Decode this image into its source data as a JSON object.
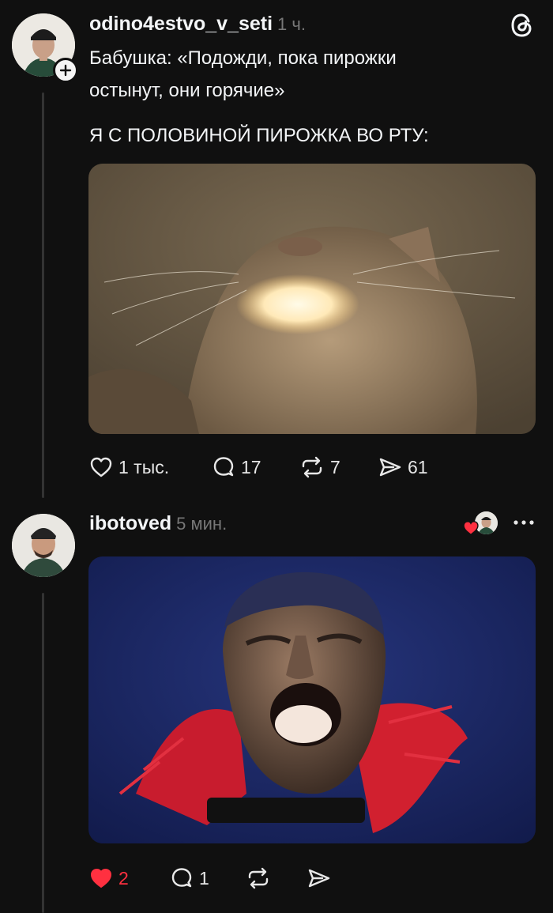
{
  "post1": {
    "username": "odino4estvo_v_seti",
    "time": "1 ч.",
    "text_line1": "Бабушка: «Подожди, пока пирожки",
    "text_line2": "остынут, они горячие»",
    "text_line3": "Я С ПОЛОВИНОЙ ПИРОЖКА ВО РТУ:",
    "actions": {
      "likes": "1 тыс.",
      "comments": "17",
      "reposts": "7",
      "shares": "61"
    }
  },
  "post2": {
    "username": "ibotoved",
    "time": "5 мин.",
    "actions": {
      "likes": "2",
      "comments": "1"
    }
  },
  "icons": {
    "app_logo": "threads-logo-icon",
    "follow": "plus-icon",
    "like": "heart-icon",
    "comment": "comment-icon",
    "repost": "repost-icon",
    "share": "send-icon",
    "more": "more-icon"
  },
  "colors": {
    "background": "#101010",
    "liked_red": "#ff3040",
    "muted": "#777777"
  }
}
